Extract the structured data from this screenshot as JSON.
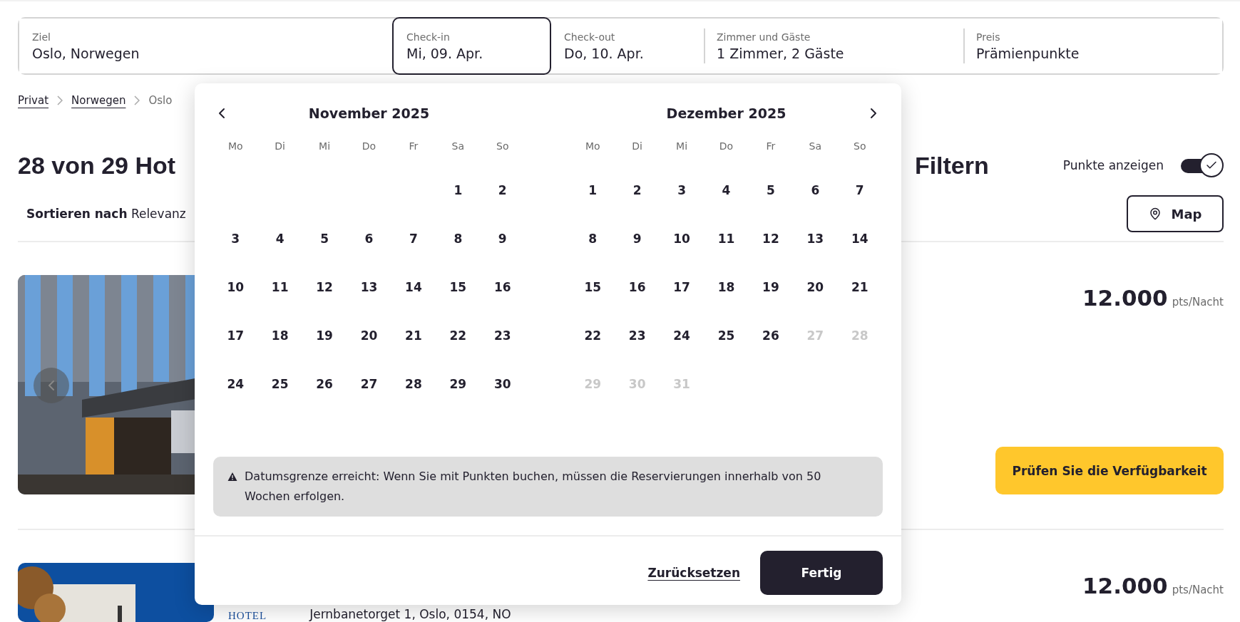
{
  "search_bar": {
    "fields": [
      {
        "label": "Ziel",
        "value": "Oslo, Norwegen",
        "selected": false
      },
      {
        "label": "Check-in",
        "value": "Mi, 09. Apr.",
        "selected": true
      },
      {
        "label": "Check-out",
        "value": "Do, 10. Apr.",
        "selected": false
      },
      {
        "label": "Zimmer und Gäste",
        "value": "1 Zimmer, 2 Gäste",
        "selected": false
      },
      {
        "label": "Preis",
        "value": "Prämienpunkte",
        "selected": false
      }
    ]
  },
  "breadcrumb": [
    {
      "label": "Privat",
      "current": false
    },
    {
      "label": "Norwegen",
      "current": false
    },
    {
      "label": "Oslo",
      "current": true
    }
  ],
  "title_start": "28 von 29 Hot",
  "title_end": "Filtern",
  "points_toggle": {
    "label": "Punkte anzeigen",
    "on": true
  },
  "sort": {
    "label": "Sortieren nach",
    "value": "Relevanz"
  },
  "map_button": "Map",
  "hotels": [
    {
      "price": "12.000",
      "unit": "pts/Nacht",
      "button": "Prüfen Sie die Verfügbarkeit"
    },
    {
      "price": "12.000",
      "unit": "pts/Nacht",
      "logo": "HOTEL",
      "address": "Jernbanetorget 1, Oslo, 0154, NO"
    }
  ],
  "calendar": {
    "months": [
      {
        "title": "November 2025",
        "weekdays": [
          "Mo",
          "Di",
          "Mi",
          "Do",
          "Fr",
          "Sa",
          "So"
        ],
        "weeks": [
          [
            {
              "day": "1",
              "disabled": false
            },
            {
              "day": "2",
              "disabled": false
            }
          ],
          [
            {
              "day": "3",
              "disabled": false
            },
            {
              "day": "4",
              "disabled": false
            },
            {
              "day": "5",
              "disabled": false
            },
            {
              "day": "6",
              "disabled": false
            },
            {
              "day": "7",
              "disabled": false
            },
            {
              "day": "8",
              "disabled": false
            },
            {
              "day": "9",
              "disabled": false
            }
          ],
          [
            {
              "day": "10",
              "disabled": false
            },
            {
              "day": "11",
              "disabled": false
            },
            {
              "day": "12",
              "disabled": false
            },
            {
              "day": "13",
              "disabled": false
            },
            {
              "day": "14",
              "disabled": false
            },
            {
              "day": "15",
              "disabled": false
            },
            {
              "day": "16",
              "disabled": false
            }
          ],
          [
            {
              "day": "17",
              "disabled": false
            },
            {
              "day": "18",
              "disabled": false
            },
            {
              "day": "19",
              "disabled": false
            },
            {
              "day": "20",
              "disabled": false
            },
            {
              "day": "21",
              "disabled": false
            },
            {
              "day": "22",
              "disabled": false
            },
            {
              "day": "23",
              "disabled": false
            }
          ],
          [
            {
              "day": "24",
              "disabled": false
            },
            {
              "day": "25",
              "disabled": false
            },
            {
              "day": "26",
              "disabled": false
            },
            {
              "day": "27",
              "disabled": false
            },
            {
              "day": "28",
              "disabled": false
            },
            {
              "day": "29",
              "disabled": false
            },
            {
              "day": "30",
              "disabled": false
            }
          ]
        ]
      },
      {
        "title": "Dezember 2025",
        "weekdays": [
          "Mo",
          "Di",
          "Mi",
          "Do",
          "Fr",
          "Sa",
          "So"
        ],
        "weeks": [
          [
            {
              "day": "1",
              "disabled": false
            },
            {
              "day": "2",
              "disabled": false
            },
            {
              "day": "3",
              "disabled": false
            },
            {
              "day": "4",
              "disabled": false
            },
            {
              "day": "5",
              "disabled": false
            },
            {
              "day": "6",
              "disabled": false
            },
            {
              "day": "7",
              "disabled": false
            }
          ],
          [
            {
              "day": "8",
              "disabled": false
            },
            {
              "day": "9",
              "disabled": false
            },
            {
              "day": "10",
              "disabled": false
            },
            {
              "day": "11",
              "disabled": false
            },
            {
              "day": "12",
              "disabled": false
            },
            {
              "day": "13",
              "disabled": false
            },
            {
              "day": "14",
              "disabled": false
            }
          ],
          [
            {
              "day": "15",
              "disabled": false
            },
            {
              "day": "16",
              "disabled": false
            },
            {
              "day": "17",
              "disabled": false
            },
            {
              "day": "18",
              "disabled": false
            },
            {
              "day": "19",
              "disabled": false
            },
            {
              "day": "20",
              "disabled": false
            },
            {
              "day": "21",
              "disabled": false
            }
          ],
          [
            {
              "day": "22",
              "disabled": false
            },
            {
              "day": "23",
              "disabled": false
            },
            {
              "day": "24",
              "disabled": false
            },
            {
              "day": "25",
              "disabled": false
            },
            {
              "day": "26",
              "disabled": false
            },
            {
              "day": "27",
              "disabled": true
            },
            {
              "day": "28",
              "disabled": true
            }
          ],
          [
            {
              "day": "29",
              "disabled": true
            },
            {
              "day": "30",
              "disabled": true
            },
            {
              "day": "31",
              "disabled": true
            }
          ]
        ]
      }
    ],
    "alert": "Datumsgrenze erreicht: Wenn Sie mit Punkten buchen, müssen die Reservierungen innerhalb von 50 Wochen erfolgen.",
    "reset": "Zurücksetzen",
    "done": "Fertig"
  }
}
